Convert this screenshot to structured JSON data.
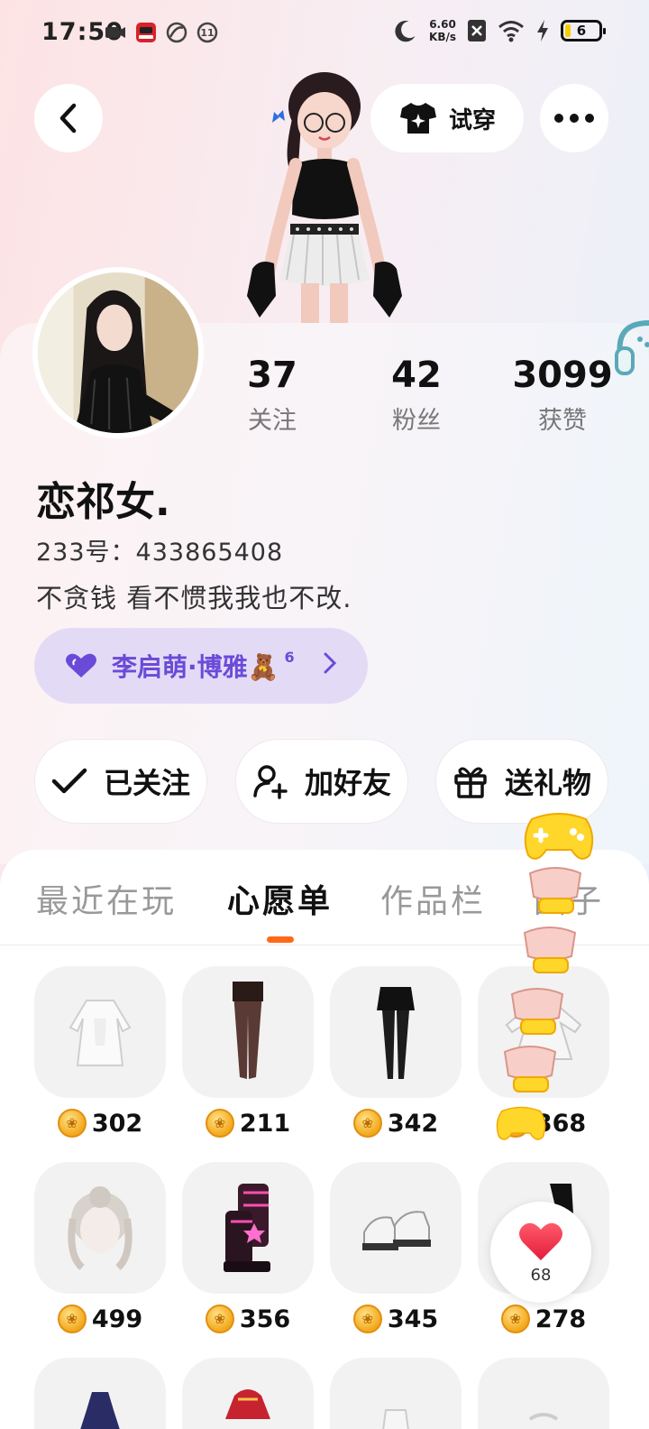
{
  "status_bar": {
    "time": "17:50",
    "net_speed": "6.60",
    "net_unit": "KB/s",
    "battery": "6"
  },
  "header": {
    "tryon_label": "试穿"
  },
  "profile": {
    "stats": [
      {
        "value": "37",
        "label": "关注"
      },
      {
        "value": "42",
        "label": "粉丝"
      },
      {
        "value": "3099",
        "label": "获赞"
      }
    ],
    "nickname": "恋祁女.",
    "id_label": "233号：",
    "id_value": "433865408",
    "bio": "不贪钱 看不惯我我也不改.",
    "cp_name": "李启萌·博雅🧸",
    "cp_level": "6"
  },
  "actions": {
    "followed_label": "已关注",
    "add_friend_label": "加好友",
    "gift_label": "送礼物"
  },
  "tabs": [
    {
      "label": "最近在玩",
      "active": false
    },
    {
      "label": "心愿单",
      "active": true
    },
    {
      "label": "作品栏",
      "active": false
    },
    {
      "label": "圈子",
      "active": false
    }
  ],
  "wishlist": [
    {
      "name": "white-dress-item",
      "price": "302"
    },
    {
      "name": "brown-tights-item",
      "price": "211"
    },
    {
      "name": "black-skirt-stockings-item",
      "price": "342"
    },
    {
      "name": "white-frill-dress-item",
      "price": "368"
    },
    {
      "name": "silver-hair-item",
      "price": "499"
    },
    {
      "name": "pink-star-boots-item",
      "price": "356"
    },
    {
      "name": "white-platform-shoes-item",
      "price": "345"
    },
    {
      "name": "black-pants-item",
      "price": "278"
    }
  ],
  "like": {
    "count": "68"
  },
  "colors": {
    "accent_orange": "#ff6a1a",
    "cp_purple": "#6a4bd8",
    "cp_bg": "#e3dbf6",
    "heart_red": "#f0314a"
  }
}
